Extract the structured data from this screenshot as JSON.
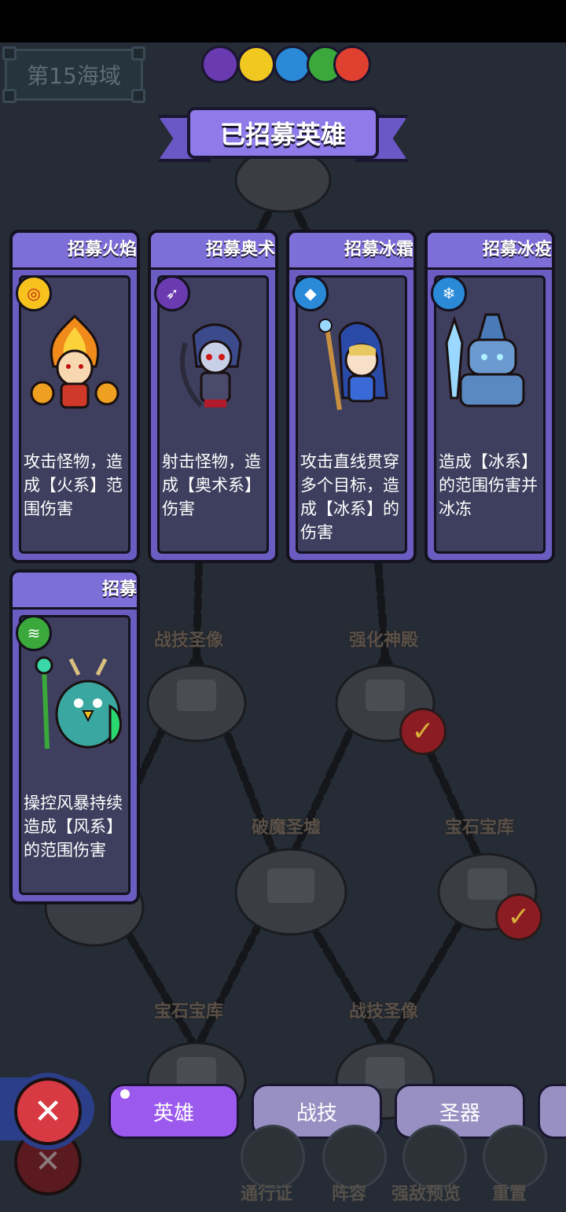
{
  "map": {
    "area_badge": "第15海域",
    "nodes": [
      {
        "label": "战技圣像"
      },
      {
        "label": "强化神殿",
        "checked": true
      },
      {
        "label": "破魔圣墟"
      },
      {
        "label": "宝石宝库",
        "checked": true
      },
      {
        "label": "宝石宝库"
      },
      {
        "label": "战技圣像"
      }
    ]
  },
  "panel": {
    "title": "已招募英雄",
    "element_orbs": [
      "arcane",
      "lightning",
      "ice",
      "wind",
      "fire"
    ]
  },
  "cards": [
    {
      "title": "招募火焰",
      "element_icon": "fire-element-icon",
      "element_color": "#f7c21e",
      "hero": "fire-hero",
      "description": "攻击怪物，造成【火系】范围伤害"
    },
    {
      "title": "招募奥术",
      "element_icon": "arcane-element-icon",
      "element_color": "#6a3ab0",
      "hero": "arcane-archer-hero",
      "description": "射击怪物，造成【奥术系】伤害"
    },
    {
      "title": "招募冰霜",
      "element_icon": "ice-element-icon",
      "element_color": "#2a8ad8",
      "hero": "ice-mage-hero",
      "description": "攻击直线贯穿多个目标，造成【冰系】的伤害"
    },
    {
      "title": "招募冰疫",
      "element_icon": "ice-plague-element-icon",
      "element_color": "#2a8ad8",
      "hero": "ice-knight-hero",
      "description": "造成【冰系】的范围伤害并冰冻"
    },
    {
      "title": "招募",
      "element_icon": "wind-element-icon",
      "element_color": "#3aa83a",
      "hero": "wind-bird-hero",
      "description": "操控风暴持续造成【风系】的范围伤害"
    }
  ],
  "tabs": [
    {
      "label": "英雄",
      "active": true
    },
    {
      "label": "战技",
      "active": false
    },
    {
      "label": "圣器",
      "active": false
    }
  ],
  "footer": [
    "通行证",
    "阵容",
    "强敌预览",
    "重置"
  ],
  "colors": {
    "accent": "#9b59ee",
    "card": "#6a5cc0",
    "close": "#d83a44"
  }
}
